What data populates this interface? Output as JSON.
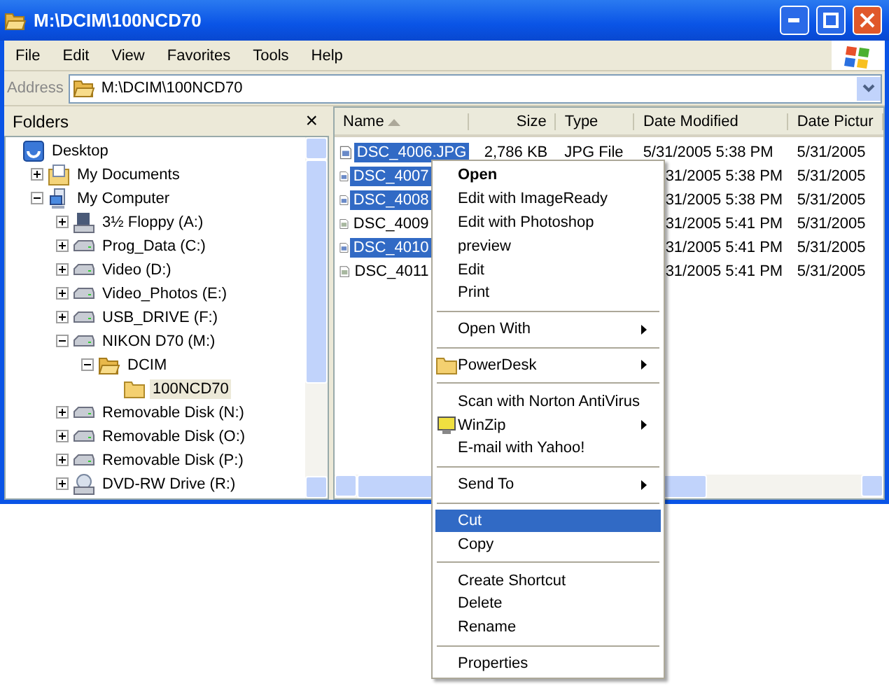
{
  "window": {
    "title": "M:\\DCIM\\100NCD70"
  },
  "menu_bar": [
    "File",
    "Edit",
    "View",
    "Favorites",
    "Tools",
    "Help"
  ],
  "address": {
    "label": "Address",
    "value": "M:\\DCIM\\100NCD70"
  },
  "folders": {
    "title": "Folders",
    "close": "×",
    "tree": [
      {
        "label": "Desktop",
        "kind": "desktop",
        "selected": false,
        "children": [
          {
            "label": "My Documents",
            "kind": "documents",
            "expanded": false,
            "selected": false
          },
          {
            "label": "My Computer",
            "kind": "computer",
            "expanded": true,
            "selected": false,
            "children": [
              {
                "label": "3½ Floppy (A:)",
                "kind": "floppy",
                "expanded": false,
                "selected": false
              },
              {
                "label": "Prog_Data (C:)",
                "kind": "drive",
                "expanded": false,
                "selected": false
              },
              {
                "label": "Video (D:)",
                "kind": "drive",
                "expanded": false,
                "selected": false
              },
              {
                "label": "Video_Photos (E:)",
                "kind": "drive",
                "expanded": false,
                "selected": false
              },
              {
                "label": "USB_DRIVE (F:)",
                "kind": "drive",
                "expanded": false,
                "selected": false
              },
              {
                "label": "NIKON D70 (M:)",
                "kind": "drive",
                "expanded": true,
                "selected": false,
                "children": [
                  {
                    "label": "DCIM",
                    "kind": "folder-open",
                    "expanded": true,
                    "selected": false,
                    "children": [
                      {
                        "label": "100NCD70",
                        "kind": "folder",
                        "selected": true
                      }
                    ]
                  }
                ]
              },
              {
                "label": "Removable Disk (N:)",
                "kind": "drive",
                "expanded": false,
                "selected": false
              },
              {
                "label": "Removable Disk (O:)",
                "kind": "drive",
                "expanded": false,
                "selected": false
              },
              {
                "label": "Removable Disk (P:)",
                "kind": "drive",
                "expanded": false,
                "selected": false
              },
              {
                "label": "DVD-RW Drive (R:)",
                "kind": "dvd",
                "expanded": false,
                "selected": false
              }
            ]
          }
        ]
      }
    ]
  },
  "files": {
    "columns": [
      "Name",
      "Size",
      "Type",
      "Date Modified",
      "Date Pictur"
    ],
    "rows": [
      {
        "name": "DSC_4006.JPG",
        "size": "2,786 KB",
        "type": "JPG File",
        "date_modified": "5/31/2005 5:38 PM",
        "date_picture": "5/31/2005",
        "selected": true
      },
      {
        "name": "DSC_4007",
        "date_modified": "31/2005 5:38 PM",
        "date_picture": "5/31/2005",
        "selected": true
      },
      {
        "name": "DSC_4008",
        "date_modified": "31/2005 5:38 PM",
        "date_picture": "5/31/2005",
        "selected": true
      },
      {
        "name": "DSC_4009",
        "date_modified": "31/2005 5:41 PM",
        "date_picture": "5/31/2005",
        "selected": false
      },
      {
        "name": "DSC_4010",
        "date_modified": "31/2005 5:41 PM",
        "date_picture": "5/31/2005",
        "selected": true
      },
      {
        "name": "DSC_4011",
        "date_modified": "31/2005 5:41 PM",
        "date_picture": "5/31/2005",
        "selected": false
      }
    ]
  },
  "context_menu": [
    {
      "kind": "item",
      "label": "Open",
      "default": true,
      "selected": false
    },
    {
      "kind": "item",
      "label": "Edit with ImageReady",
      "selected": false
    },
    {
      "kind": "item",
      "label": "Edit with Photoshop",
      "selected": false
    },
    {
      "kind": "item",
      "label": "preview",
      "selected": false
    },
    {
      "kind": "item",
      "label": "Edit",
      "selected": false
    },
    {
      "kind": "item",
      "label": "Print",
      "selected": false
    },
    {
      "kind": "separator"
    },
    {
      "kind": "item",
      "label": "Open With",
      "submenu": true,
      "selected": false
    },
    {
      "kind": "separator"
    },
    {
      "kind": "folder-item",
      "label": "PowerDesk",
      "submenu": true,
      "selected": false
    },
    {
      "kind": "separator"
    },
    {
      "kind": "item",
      "label": "Scan with Norton AntiVirus",
      "selected": false
    },
    {
      "kind": "archive-item",
      "label": "WinZip",
      "submenu": true,
      "selected": false
    },
    {
      "kind": "item",
      "label": "E-mail with Yahoo!",
      "selected": false
    },
    {
      "kind": "separator"
    },
    {
      "kind": "item",
      "label": "Send To",
      "submenu": true,
      "selected": false
    },
    {
      "kind": "separator"
    },
    {
      "kind": "item",
      "label": "Cut",
      "selected": true
    },
    {
      "kind": "item",
      "label": "Copy",
      "selected": false
    },
    {
      "kind": "separator"
    },
    {
      "kind": "item",
      "label": "Create Shortcut",
      "selected": false
    },
    {
      "kind": "item",
      "label": "Delete",
      "selected": false
    },
    {
      "kind": "item",
      "label": "Rename",
      "selected": false
    },
    {
      "kind": "separator"
    },
    {
      "kind": "item",
      "label": "Properties",
      "selected": false
    }
  ]
}
